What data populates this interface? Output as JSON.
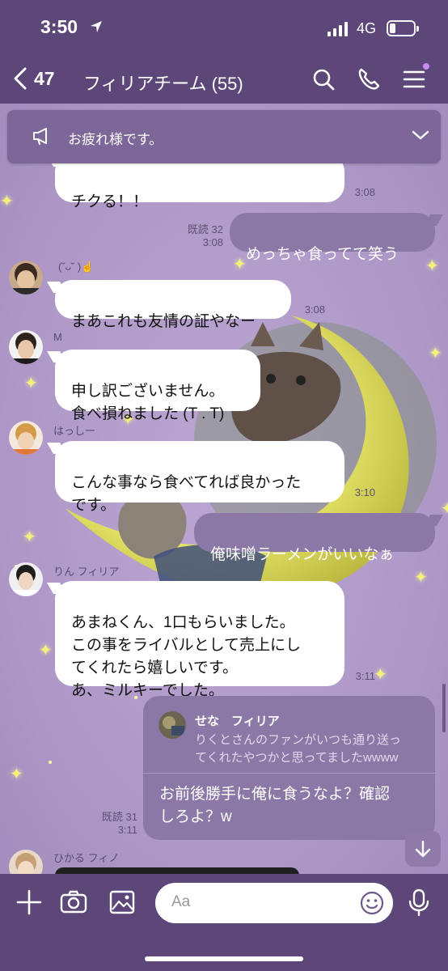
{
  "status": {
    "time": "3:50",
    "network": "4G",
    "battery_level": 0.25
  },
  "header": {
    "back_count": "47",
    "title": "フィリアチーム (55)"
  },
  "announcement": {
    "text": "お疲れ様です。"
  },
  "messages": [
    {
      "type": "in",
      "text": "俺のモノマネちゃんと食べたからチクる！！",
      "visible_text": "チクる！！",
      "time": "3:08"
    },
    {
      "type": "out",
      "text": "めっちゃ食ってて笑う",
      "read": "既読 32",
      "time": "3:08"
    },
    {
      "type": "in",
      "sender": "(˘ᴗ˘ )☝",
      "text": "まあこれも友情の証やなー",
      "time": "3:08"
    },
    {
      "type": "in",
      "sender": "M",
      "text": "申し訳ございません。\n食べ損ねました (T . T)"
    },
    {
      "type": "in",
      "sender": "はっしー",
      "text": "こんな事なら食べてれば良かった\nです。",
      "time": "3:10"
    },
    {
      "type": "out",
      "text": "俺味噌ラーメンがいいなぁ"
    },
    {
      "type": "in",
      "sender": "りん フィリア",
      "text": "あまねくん、1口もらいました。\nこの事をライバルとして売上にし\nてくれたら嬉しいです。\nあ、ミルキーでした。",
      "time": "3:11"
    },
    {
      "type": "reply",
      "quote_name": "せな　フィリア",
      "quote_text": "りくとさんのファンがいつも通り送っ\nてくれたやつかと思ってましたwwww",
      "text": "お前後勝手に俺に食うなよ？確認\nしろよ？w",
      "read": "既読 31",
      "time": "3:11"
    },
    {
      "type": "in",
      "sender": "ひかる フィノ"
    }
  ],
  "composer": {
    "placeholder": "Aa"
  },
  "icons": [
    "back-chevron-icon",
    "search-icon",
    "phone-icon",
    "menu-icon",
    "megaphone-icon",
    "chevron-down-icon",
    "plus-icon",
    "camera-icon",
    "image-icon",
    "emoji-icon",
    "microphone-icon",
    "arrow-down-icon"
  ],
  "colors": {
    "header_bg": "#5c4778",
    "chat_bg": "#b7a2cd",
    "outgoing_bubble": "#8c78a6",
    "incoming_bubble": "#ffffff",
    "moon": "#e9e86a"
  }
}
